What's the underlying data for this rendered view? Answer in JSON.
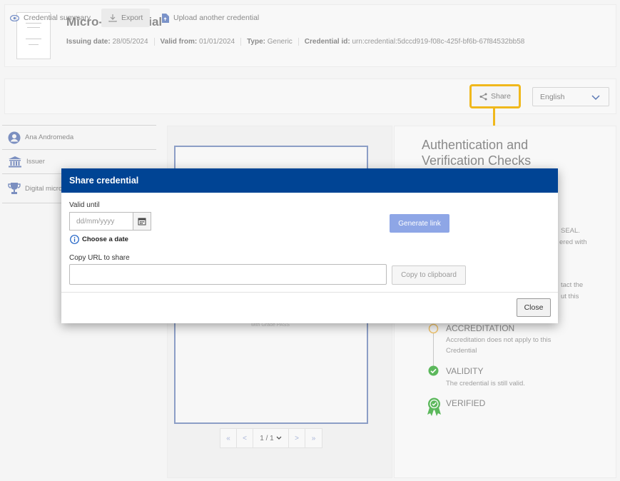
{
  "header": {
    "title": "Micro-Credential",
    "meta": [
      {
        "label": "Issuing date:",
        "value": "28/05/2024"
      },
      {
        "label": "Valid from:",
        "value": "01/01/2024"
      },
      {
        "label": "Type:",
        "value": "Generic"
      },
      {
        "label": "Credential id:",
        "value": "urn:credential:5dccd919-f08c-425f-bf6b-67f84532bb58"
      }
    ]
  },
  "toolbar": {
    "summary_label": "Credential summary",
    "export_label": "Export",
    "upload_label": "Upload another credential",
    "share_label": "Share",
    "language": "English"
  },
  "sidebar": {
    "items": [
      {
        "label": "Ana Andromeda",
        "icon": "person-icon"
      },
      {
        "label": "Issuer",
        "icon": "institution-icon"
      },
      {
        "label": "Digital micro",
        "icon": "trophy-icon"
      }
    ]
  },
  "viewer": {
    "doc_text": "with Grade PASS",
    "pager": {
      "first": "«",
      "prev": "<",
      "page": "1 / 1",
      "next": ">",
      "last": "»"
    }
  },
  "verification": {
    "title": "Authentication and Verification Checks",
    "peek_lines": [
      "SEAL.",
      "ered with",
      "tact the",
      "ut this"
    ],
    "checks": [
      {
        "title": "ACCREDITATION",
        "desc": "Accreditation does not apply to this Credential",
        "status": "pending"
      },
      {
        "title": "VALIDITY",
        "desc": "The credential is still valid.",
        "status": "ok"
      },
      {
        "title": "VERIFIED",
        "desc": "",
        "status": "verified"
      }
    ]
  },
  "modal": {
    "title": "Share credential",
    "valid_until_label": "Valid until",
    "date_placeholder": "dd/mm/yyyy",
    "hint": "Choose a date",
    "generate_label": "Generate link",
    "copy_url_label": "Copy URL to share",
    "url_value": "",
    "copy_button_label": "Copy to clipboard",
    "close_label": "Close"
  },
  "colors": {
    "modal_header": "#004494",
    "highlight": "#f0b81c",
    "primary_button": "#8ea6e6",
    "ok_green": "#5cb85c"
  }
}
